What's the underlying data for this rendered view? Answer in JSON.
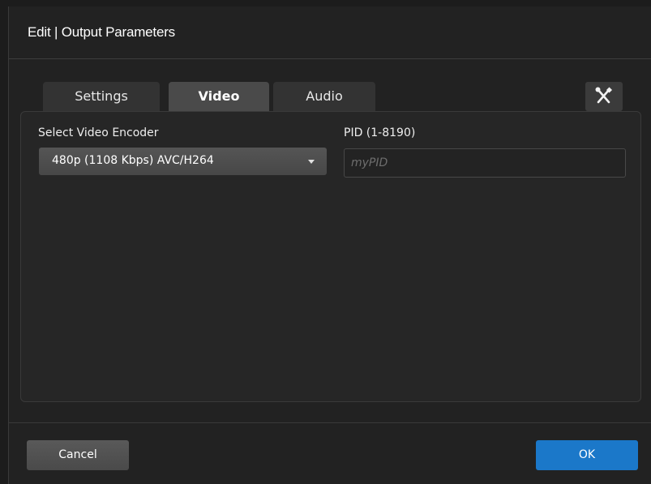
{
  "dialog": {
    "title": "Edit | Output Parameters"
  },
  "tabs": [
    {
      "label": "Settings",
      "active": false
    },
    {
      "label": "Video",
      "active": true
    },
    {
      "label": "Audio",
      "active": false
    }
  ],
  "tools_button": {
    "icon": "tools-icon"
  },
  "video": {
    "encoder_label": "Select Video Encoder",
    "encoder_value": "480p (1108 Kbps) AVC/H264",
    "pid_label": "PID (1-8190)",
    "pid_value": "",
    "pid_placeholder": "myPID"
  },
  "footer": {
    "cancel_label": "Cancel",
    "ok_label": "OK"
  },
  "colors": {
    "background": "#222222",
    "active_tab": "#4a4a4a",
    "ok_button": "#1b78c9"
  }
}
